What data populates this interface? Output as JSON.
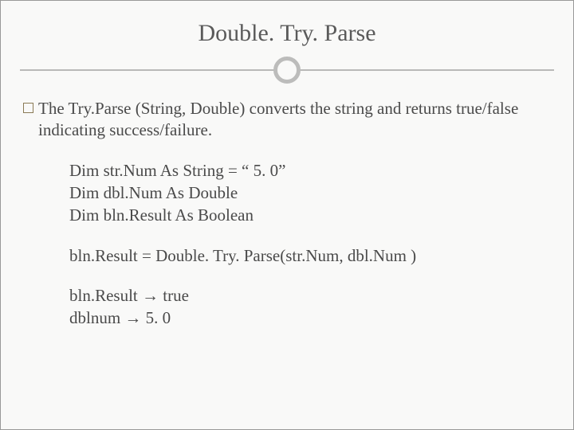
{
  "title": "Double. Try. Parse",
  "bullet": "The Try.Parse (String, Double) converts the string and returns true/false indicating success/failure.",
  "code": {
    "decl1": "Dim str.Num As String = “ 5. 0”",
    "decl2": "Dim dbl.Num As Double",
    "decl3": "Dim bln.Result As Boolean",
    "assign": "bln.Result = Double. Try. Parse(str.Num, dbl.Num )",
    "res1": "bln.Result → true",
    "res2": "dblnum → 5. 0"
  }
}
